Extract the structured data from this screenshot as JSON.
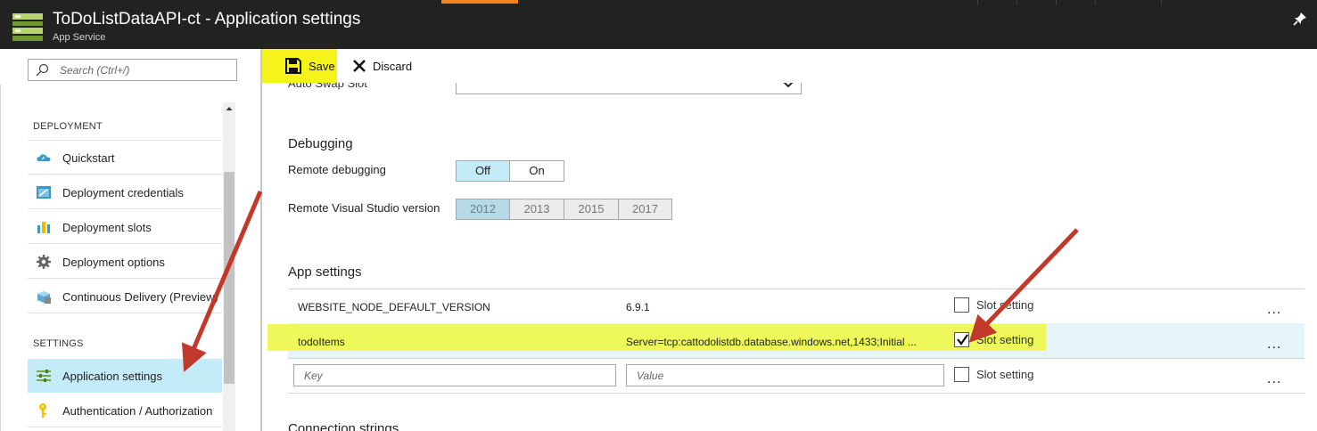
{
  "window": {
    "title": "ToDoListDataAPI-ct - Application settings",
    "subtitle": "App Service",
    "icons": {
      "logo": "app-service-icon",
      "pin": "pin-icon"
    }
  },
  "search": {
    "placeholder": "Search (Ctrl+/)",
    "icon": "search-icon"
  },
  "sidebar": {
    "deployment_header": "DEPLOYMENT",
    "settings_header": "SETTINGS",
    "items": [
      {
        "label": "Quickstart",
        "icon": "cloud-icon"
      },
      {
        "label": "Deployment credentials",
        "icon": "credentials-icon"
      },
      {
        "label": "Deployment slots",
        "icon": "slots-icon"
      },
      {
        "label": "Deployment options",
        "icon": "gear-icon"
      },
      {
        "label": "Continuous Delivery (Preview)",
        "icon": "delivery-icon"
      },
      {
        "label": "Application settings",
        "icon": "settings-sliders-icon",
        "active": true
      },
      {
        "label": "Authentication / Authorization",
        "icon": "key-icon"
      }
    ]
  },
  "toolbar": {
    "save_label": "Save",
    "discard_label": "Discard"
  },
  "general": {
    "auto_swap_label": "Auto Swap Slot"
  },
  "debugging": {
    "title": "Debugging",
    "remote_label": "Remote debugging",
    "remote_options": [
      "Off",
      "On"
    ],
    "remote_selected": "Off",
    "vs_label": "Remote Visual Studio version",
    "vs_options": [
      "2012",
      "2013",
      "2015",
      "2017"
    ],
    "vs_selected": "2012"
  },
  "app_settings": {
    "title": "App settings",
    "slot_label": "Slot setting",
    "more": "...",
    "rows": [
      {
        "key": "WEBSITE_NODE_DEFAULT_VERSION",
        "value": "6.9.1",
        "slot": false
      },
      {
        "key": "todoItems",
        "value": "Server=tcp:cattodolistdb.database.windows.net,1433;Initial ...",
        "slot": true
      }
    ],
    "new_row": {
      "key_placeholder": "Key",
      "value_placeholder": "Value",
      "slot": false
    }
  },
  "connection_strings": {
    "title": "Connection strings"
  },
  "colors": {
    "titlebar": "#222222",
    "accent_orange": "#f58220",
    "selection_blue": "#c4ecf8",
    "highlight_yellow": "#eef85a",
    "annotation_arrow": "#c0392b"
  }
}
